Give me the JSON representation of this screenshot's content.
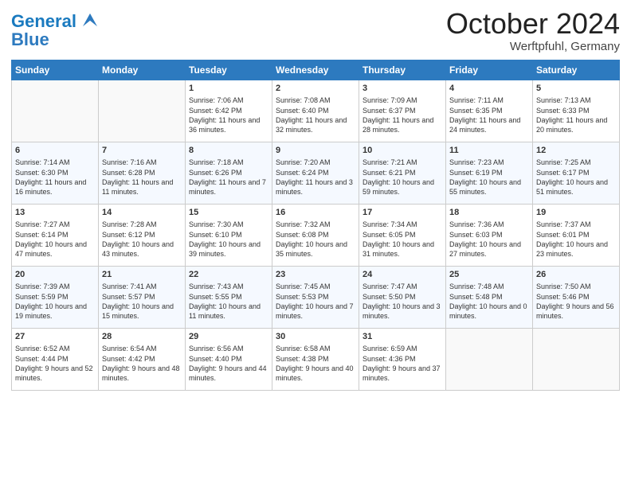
{
  "header": {
    "logo_line1": "General",
    "logo_line2": "Blue",
    "month_title": "October 2024",
    "location": "Werftpfuhl, Germany"
  },
  "weekdays": [
    "Sunday",
    "Monday",
    "Tuesday",
    "Wednesday",
    "Thursday",
    "Friday",
    "Saturday"
  ],
  "weeks": [
    [
      {
        "day": "",
        "detail": ""
      },
      {
        "day": "",
        "detail": ""
      },
      {
        "day": "1",
        "detail": "Sunrise: 7:06 AM\nSunset: 6:42 PM\nDaylight: 11 hours and 36 minutes."
      },
      {
        "day": "2",
        "detail": "Sunrise: 7:08 AM\nSunset: 6:40 PM\nDaylight: 11 hours and 32 minutes."
      },
      {
        "day": "3",
        "detail": "Sunrise: 7:09 AM\nSunset: 6:37 PM\nDaylight: 11 hours and 28 minutes."
      },
      {
        "day": "4",
        "detail": "Sunrise: 7:11 AM\nSunset: 6:35 PM\nDaylight: 11 hours and 24 minutes."
      },
      {
        "day": "5",
        "detail": "Sunrise: 7:13 AM\nSunset: 6:33 PM\nDaylight: 11 hours and 20 minutes."
      }
    ],
    [
      {
        "day": "6",
        "detail": "Sunrise: 7:14 AM\nSunset: 6:30 PM\nDaylight: 11 hours and 16 minutes."
      },
      {
        "day": "7",
        "detail": "Sunrise: 7:16 AM\nSunset: 6:28 PM\nDaylight: 11 hours and 11 minutes."
      },
      {
        "day": "8",
        "detail": "Sunrise: 7:18 AM\nSunset: 6:26 PM\nDaylight: 11 hours and 7 minutes."
      },
      {
        "day": "9",
        "detail": "Sunrise: 7:20 AM\nSunset: 6:24 PM\nDaylight: 11 hours and 3 minutes."
      },
      {
        "day": "10",
        "detail": "Sunrise: 7:21 AM\nSunset: 6:21 PM\nDaylight: 10 hours and 59 minutes."
      },
      {
        "day": "11",
        "detail": "Sunrise: 7:23 AM\nSunset: 6:19 PM\nDaylight: 10 hours and 55 minutes."
      },
      {
        "day": "12",
        "detail": "Sunrise: 7:25 AM\nSunset: 6:17 PM\nDaylight: 10 hours and 51 minutes."
      }
    ],
    [
      {
        "day": "13",
        "detail": "Sunrise: 7:27 AM\nSunset: 6:14 PM\nDaylight: 10 hours and 47 minutes."
      },
      {
        "day": "14",
        "detail": "Sunrise: 7:28 AM\nSunset: 6:12 PM\nDaylight: 10 hours and 43 minutes."
      },
      {
        "day": "15",
        "detail": "Sunrise: 7:30 AM\nSunset: 6:10 PM\nDaylight: 10 hours and 39 minutes."
      },
      {
        "day": "16",
        "detail": "Sunrise: 7:32 AM\nSunset: 6:08 PM\nDaylight: 10 hours and 35 minutes."
      },
      {
        "day": "17",
        "detail": "Sunrise: 7:34 AM\nSunset: 6:05 PM\nDaylight: 10 hours and 31 minutes."
      },
      {
        "day": "18",
        "detail": "Sunrise: 7:36 AM\nSunset: 6:03 PM\nDaylight: 10 hours and 27 minutes."
      },
      {
        "day": "19",
        "detail": "Sunrise: 7:37 AM\nSunset: 6:01 PM\nDaylight: 10 hours and 23 minutes."
      }
    ],
    [
      {
        "day": "20",
        "detail": "Sunrise: 7:39 AM\nSunset: 5:59 PM\nDaylight: 10 hours and 19 minutes."
      },
      {
        "day": "21",
        "detail": "Sunrise: 7:41 AM\nSunset: 5:57 PM\nDaylight: 10 hours and 15 minutes."
      },
      {
        "day": "22",
        "detail": "Sunrise: 7:43 AM\nSunset: 5:55 PM\nDaylight: 10 hours and 11 minutes."
      },
      {
        "day": "23",
        "detail": "Sunrise: 7:45 AM\nSunset: 5:53 PM\nDaylight: 10 hours and 7 minutes."
      },
      {
        "day": "24",
        "detail": "Sunrise: 7:47 AM\nSunset: 5:50 PM\nDaylight: 10 hours and 3 minutes."
      },
      {
        "day": "25",
        "detail": "Sunrise: 7:48 AM\nSunset: 5:48 PM\nDaylight: 10 hours and 0 minutes."
      },
      {
        "day": "26",
        "detail": "Sunrise: 7:50 AM\nSunset: 5:46 PM\nDaylight: 9 hours and 56 minutes."
      }
    ],
    [
      {
        "day": "27",
        "detail": "Sunrise: 6:52 AM\nSunset: 4:44 PM\nDaylight: 9 hours and 52 minutes."
      },
      {
        "day": "28",
        "detail": "Sunrise: 6:54 AM\nSunset: 4:42 PM\nDaylight: 9 hours and 48 minutes."
      },
      {
        "day": "29",
        "detail": "Sunrise: 6:56 AM\nSunset: 4:40 PM\nDaylight: 9 hours and 44 minutes."
      },
      {
        "day": "30",
        "detail": "Sunrise: 6:58 AM\nSunset: 4:38 PM\nDaylight: 9 hours and 40 minutes."
      },
      {
        "day": "31",
        "detail": "Sunrise: 6:59 AM\nSunset: 4:36 PM\nDaylight: 9 hours and 37 minutes."
      },
      {
        "day": "",
        "detail": ""
      },
      {
        "day": "",
        "detail": ""
      }
    ]
  ]
}
